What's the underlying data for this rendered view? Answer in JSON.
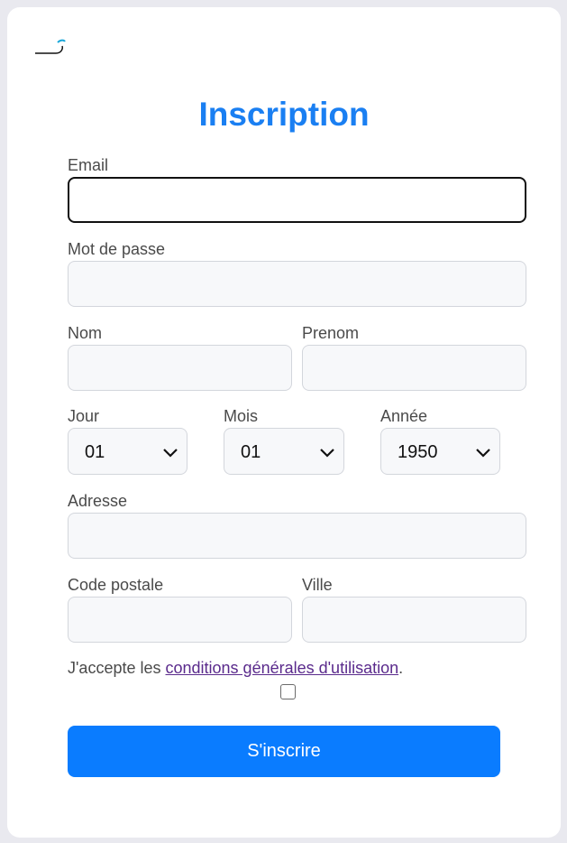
{
  "header": {
    "title": "Inscription",
    "logo_icon": "swoosh-logo-icon"
  },
  "form": {
    "email": {
      "label": "Email",
      "value": ""
    },
    "password": {
      "label": "Mot de passe",
      "value": ""
    },
    "nom": {
      "label": "Nom",
      "value": ""
    },
    "prenom": {
      "label": "Prenom",
      "value": ""
    },
    "jour": {
      "label": "Jour",
      "value": "01"
    },
    "mois": {
      "label": "Mois",
      "value": "01"
    },
    "annee": {
      "label": "Année",
      "value": "1950"
    },
    "adresse": {
      "label": "Adresse",
      "value": ""
    },
    "code_postal": {
      "label": "Code postale",
      "value": ""
    },
    "ville": {
      "label": "Ville",
      "value": ""
    },
    "terms": {
      "prefix": "J'accepte les ",
      "link": "conditions générales d'utilisation",
      "suffix": ".",
      "checked": false
    },
    "submit_label": "S'inscrire"
  },
  "colors": {
    "accent": "#0a7cff",
    "title": "#1a7ff2",
    "link": "#5a2a8c",
    "logo": "#19a7d9"
  }
}
